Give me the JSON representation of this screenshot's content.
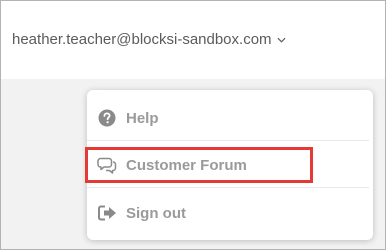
{
  "header": {
    "account_email": "heather.teacher@blocksi-sandbox.com",
    "dropdown_icon": "chevron-down-icon"
  },
  "menu": {
    "items": [
      {
        "label": "Help",
        "icon": "question-circle-icon"
      },
      {
        "label": "Customer Forum",
        "icon": "comments-icon"
      },
      {
        "label": "Sign out",
        "icon": "sign-out-icon"
      }
    ]
  },
  "colors": {
    "menu_text": "#9a9a9a",
    "header_text": "#5b5b5b",
    "highlight_border": "#e53935",
    "page_background": "#f2f2f2"
  }
}
